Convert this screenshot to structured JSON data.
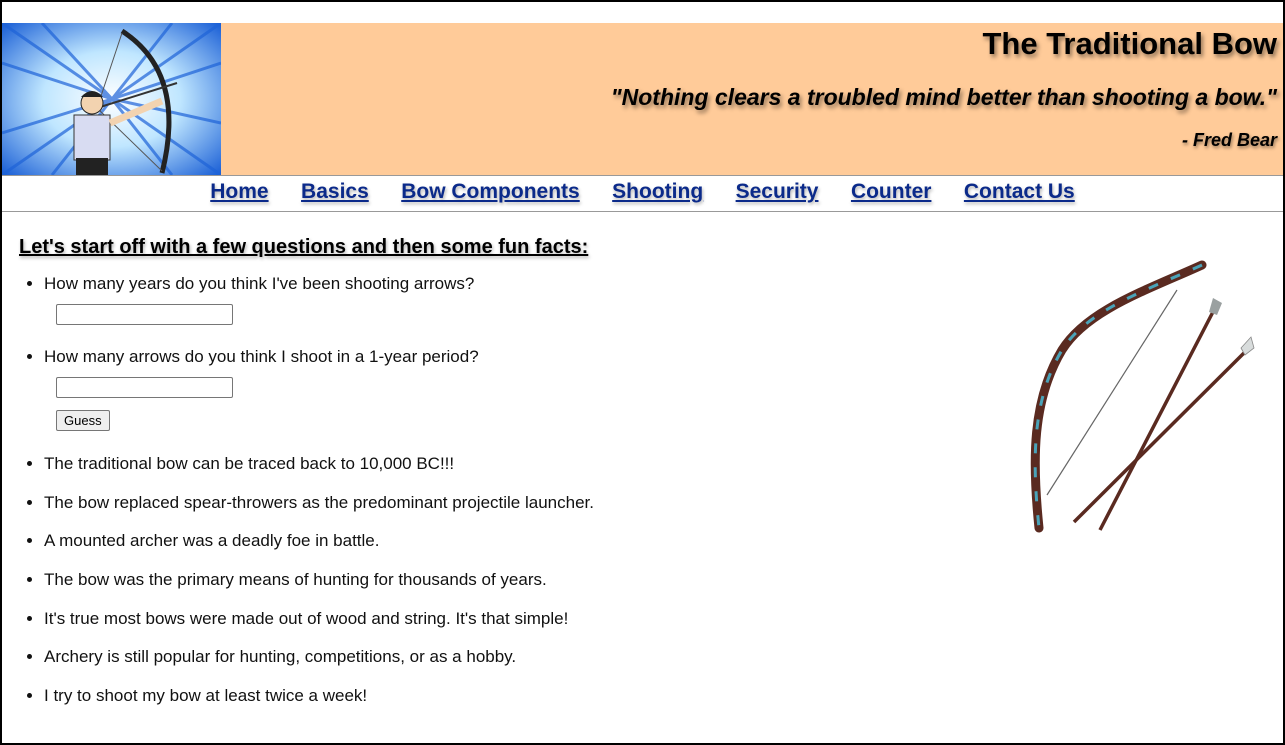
{
  "header": {
    "title": "The Traditional Bow",
    "quote": "\"Nothing clears a troubled mind better than shooting a bow.\"",
    "author": "- Fred Bear",
    "background_color": "#ffcb99",
    "logo_icon": "archer-cartoon-icon"
  },
  "nav": {
    "link_color": "#0b2a8a",
    "items": [
      {
        "label": "Home"
      },
      {
        "label": "Basics"
      },
      {
        "label": "Bow Components"
      },
      {
        "label": "Shooting"
      },
      {
        "label": "Security"
      },
      {
        "label": "Counter"
      },
      {
        "label": "Contact Us"
      }
    ]
  },
  "main": {
    "intro": "Let's start off with a few questions and then some fun facts:",
    "questions": [
      {
        "text": "How many years do you think I've been shooting arrows?",
        "value": ""
      },
      {
        "text": "How many arrows do you think I shoot in a 1-year period?",
        "value": ""
      }
    ],
    "guess_label": "Guess",
    "facts": [
      "The traditional bow can be traced back to 10,000 BC!!!",
      "The bow replaced spear-throwers as the predominant projectile launcher.",
      "A mounted archer was a deadly foe in battle.",
      "The bow was the primary means of hunting for thousands of years.",
      "It's true most bows were made out of wood and string. It's that simple!",
      "Archery is still popular for hunting, competitions, or as a hobby.",
      "I try to shoot my bow at least twice a week!"
    ],
    "side_image_icon": "bow-and-arrows-icon"
  }
}
